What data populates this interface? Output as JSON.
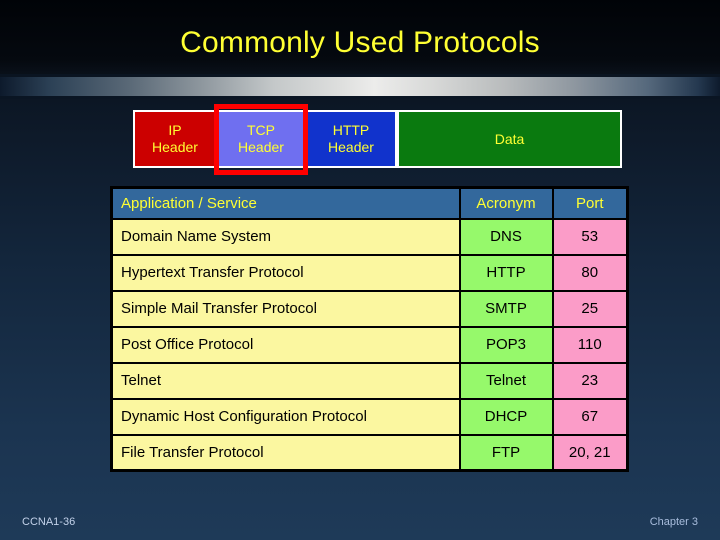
{
  "slide": {
    "title": "Commonly Used Protocols",
    "footer_left": "CCNA1-36",
    "footer_right": "Chapter 3",
    "colors": {
      "title_text": "#ffff33",
      "ip_header_bg": "#cc0000",
      "tcp_header_bg": "#6f6ff0",
      "http_header_bg": "#1133cc",
      "data_bg": "#0a7a0f",
      "highlight_border": "#ff0000",
      "table_header_bg": "#33689c",
      "name_cell_bg": "#fbf7a0",
      "acronym_cell_bg": "#96f96b",
      "port_cell_bg": "#fb9cc8"
    }
  },
  "packet": {
    "segments": [
      {
        "line1": "IP",
        "line2": "Header"
      },
      {
        "line1": "TCP",
        "line2": "Header"
      },
      {
        "line1": "HTTP",
        "line2": "Header"
      },
      {
        "line1": "Data",
        "line2": ""
      }
    ]
  },
  "table": {
    "headers": [
      "Application / Service",
      "Acronym",
      "Port"
    ],
    "rows": [
      {
        "name": "Domain Name System",
        "acronym": "DNS",
        "port": "53"
      },
      {
        "name": "Hypertext Transfer Protocol",
        "acronym": "HTTP",
        "port": "80"
      },
      {
        "name": "Simple Mail Transfer Protocol",
        "acronym": "SMTP",
        "port": "25"
      },
      {
        "name": "Post Office Protocol",
        "acronym": "POP3",
        "port": "110"
      },
      {
        "name": "Telnet",
        "acronym": "Telnet",
        "port": "23"
      },
      {
        "name": "Dynamic Host Configuration Protocol",
        "acronym": "DHCP",
        "port": "67"
      },
      {
        "name": "File Transfer Protocol",
        "acronym": "FTP",
        "port": "20, 21"
      }
    ]
  }
}
